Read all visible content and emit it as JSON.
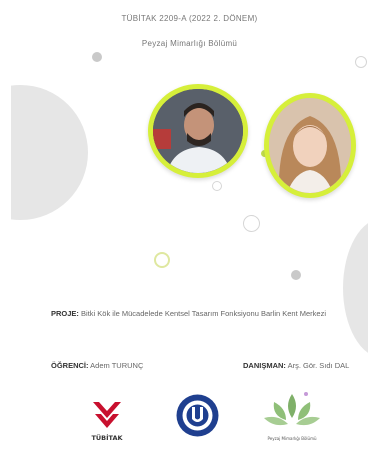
{
  "header": {
    "line1": "TÜBİTAK 2209-A (2022 2. DÖNEM)",
    "line2": "Peyzaj Mimarlığı Bölümü"
  },
  "project": {
    "label": "PROJE:",
    "text": "Bitki Kök ile Mücadelede Kentsel Tasarım Fonksiyonu Barlin Kent Merkezi"
  },
  "people": {
    "student_label": "ÖĞRENCİ:",
    "student_name": "Adem TURUNÇ",
    "advisor_label": "DANIŞMAN:",
    "advisor_name": "Arş. Gör. Sıdı DAL"
  },
  "logos": {
    "tubitak_text": "TÜBİTAK",
    "leaf_text": "Peyzaj Mimarlığı Bölümü"
  },
  "colors": {
    "accent_ring": "#d6ef3a",
    "tubitak_red": "#c8102e",
    "uni_blue": "#1f3f8f",
    "leaf_green": "#7fb069"
  }
}
